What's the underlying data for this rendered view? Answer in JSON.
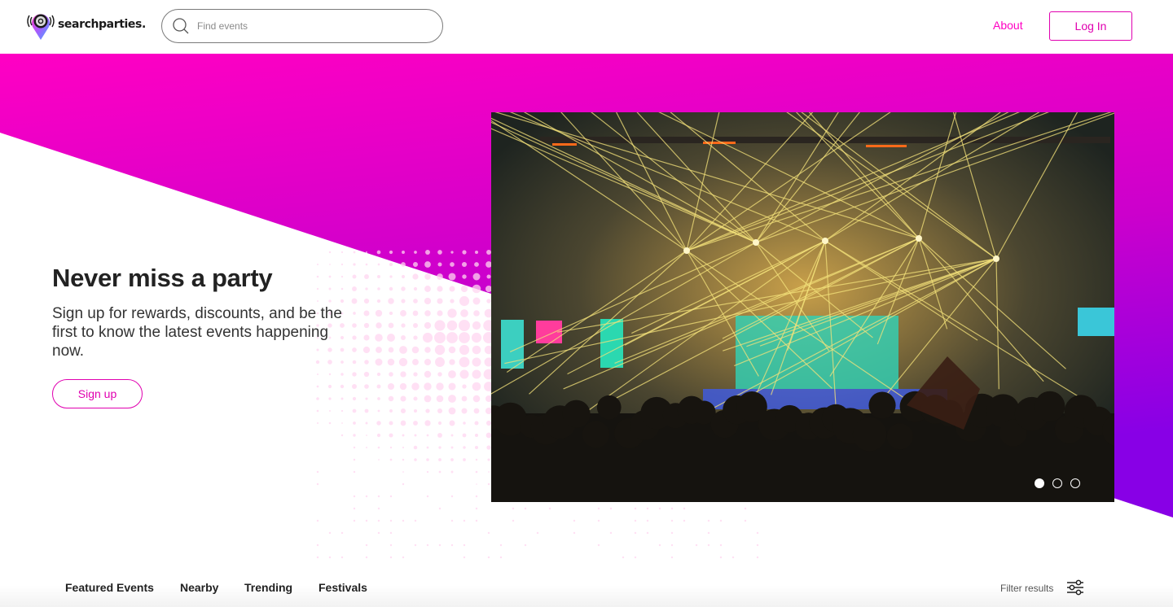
{
  "header": {
    "brand_name": "searchparties.",
    "search": {
      "placeholder": "Find events",
      "value": ""
    },
    "about_label": "About",
    "login_label": "Log In"
  },
  "hero": {
    "title": "Never miss a party",
    "subtitle": "Sign up for rewards, discounts, and be the first to know the latest events happening now.",
    "signup_label": "Sign up",
    "carousel": {
      "image_description": "Concert stage with yellow laser beams over a crowd",
      "slide_count": 3,
      "active_slide": 1
    }
  },
  "tabs": [
    {
      "label": "Featured Events"
    },
    {
      "label": "Nearby"
    },
    {
      "label": "Trending"
    },
    {
      "label": "Festivals"
    }
  ],
  "filter": {
    "label": "Filter results",
    "icon": "sliders-icon"
  },
  "colors": {
    "accent": "#ff00c3",
    "gradient_top": "#ff00c3",
    "gradient_bottom": "#8a00e6",
    "text_dark": "#222222"
  }
}
